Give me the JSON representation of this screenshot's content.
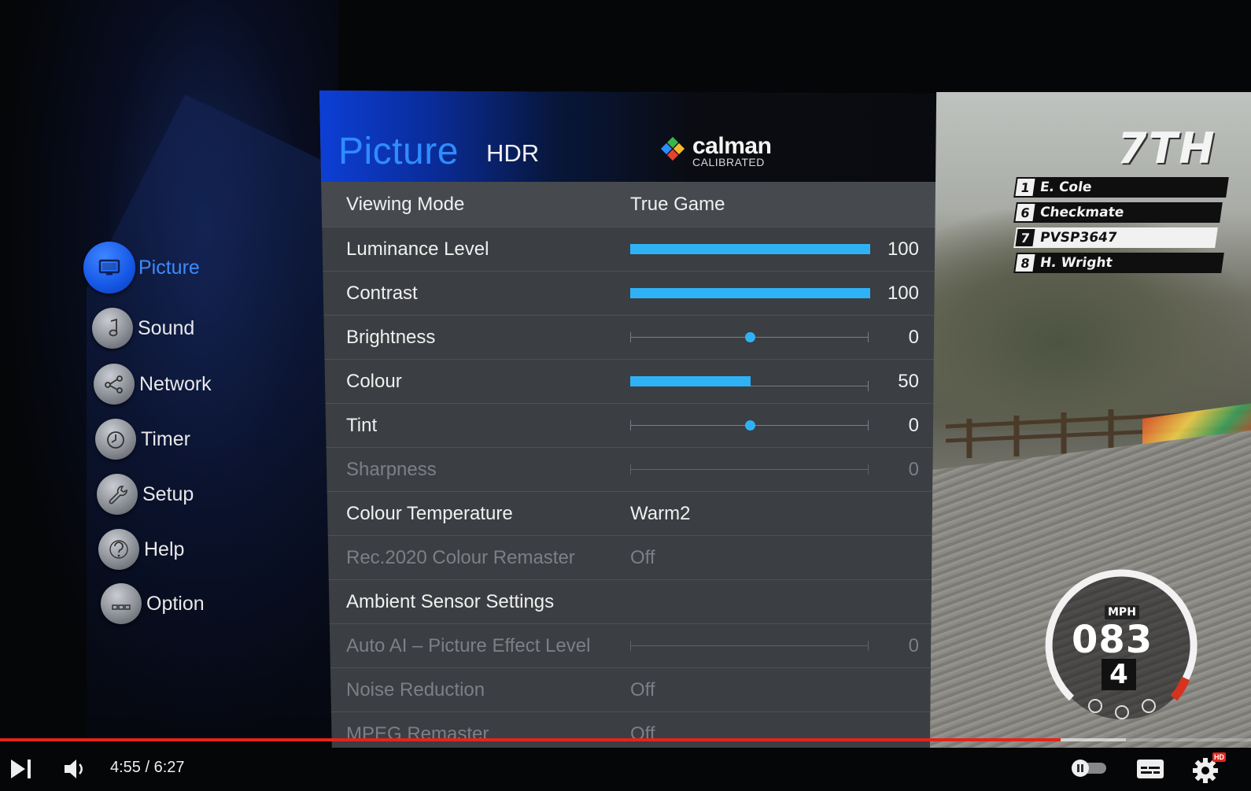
{
  "sidebar": {
    "items": [
      {
        "label": "Picture",
        "icon": "monitor-icon",
        "active": true
      },
      {
        "label": "Sound",
        "icon": "music-note-icon"
      },
      {
        "label": "Network",
        "icon": "share-network-icon"
      },
      {
        "label": "Timer",
        "icon": "clock-icon"
      },
      {
        "label": "Setup",
        "icon": "wrench-icon"
      },
      {
        "label": "Help",
        "icon": "question-icon"
      },
      {
        "label": "Option",
        "icon": "dots-icon"
      }
    ]
  },
  "panel": {
    "title": "Picture",
    "subtitle": "HDR",
    "logo": {
      "name": "calman",
      "tagline": "CALIBRATED"
    },
    "rows": [
      {
        "label": "Viewing Mode",
        "type": "value",
        "value": "True Game"
      },
      {
        "label": "Luminance Level",
        "type": "bar",
        "level": 1.0,
        "number": "100"
      },
      {
        "label": "Contrast",
        "type": "bar",
        "level": 1.0,
        "number": "100"
      },
      {
        "label": "Brightness",
        "type": "slider",
        "level": 0.5,
        "number": "0"
      },
      {
        "label": "Colour",
        "type": "bar",
        "level": 0.5,
        "number": "50"
      },
      {
        "label": "Tint",
        "type": "slider",
        "level": 0.5,
        "number": "0"
      },
      {
        "label": "Sharpness",
        "type": "slider-disabled",
        "number": "0",
        "disabled": true
      },
      {
        "label": "Colour Temperature",
        "type": "value",
        "value": "Warm2"
      },
      {
        "label": "Rec.2020 Colour Remaster",
        "type": "value",
        "value": "Off",
        "disabled": true
      },
      {
        "label": "Ambient Sensor Settings",
        "type": "none"
      },
      {
        "label": "Auto AI – Picture Effect Level",
        "type": "slider-disabled",
        "number": "0",
        "disabled": true
      },
      {
        "label": "Noise Reduction",
        "type": "value",
        "value": "Off",
        "disabled": true
      },
      {
        "label": "MPEG Remaster",
        "type": "value",
        "value": "Off",
        "disabled": true
      }
    ]
  },
  "game": {
    "position": "7TH",
    "standings": [
      {
        "pos": "1",
        "name": "E. Cole"
      },
      {
        "pos": "6",
        "name": "Checkmate"
      },
      {
        "pos": "7",
        "name": "PVSP3647",
        "highlight": true
      },
      {
        "pos": "8",
        "name": "H. Wright"
      }
    ],
    "speed_unit": "MPH",
    "speed": "083",
    "gear": "4"
  },
  "player": {
    "time": "4:55 / 6:27",
    "progress": 0.848,
    "buffered": 0.9,
    "hd_badge": "HD"
  },
  "colors": {
    "accent": "#2f8cff",
    "bar": "#2fb2f5",
    "progress": "#e4241b"
  }
}
